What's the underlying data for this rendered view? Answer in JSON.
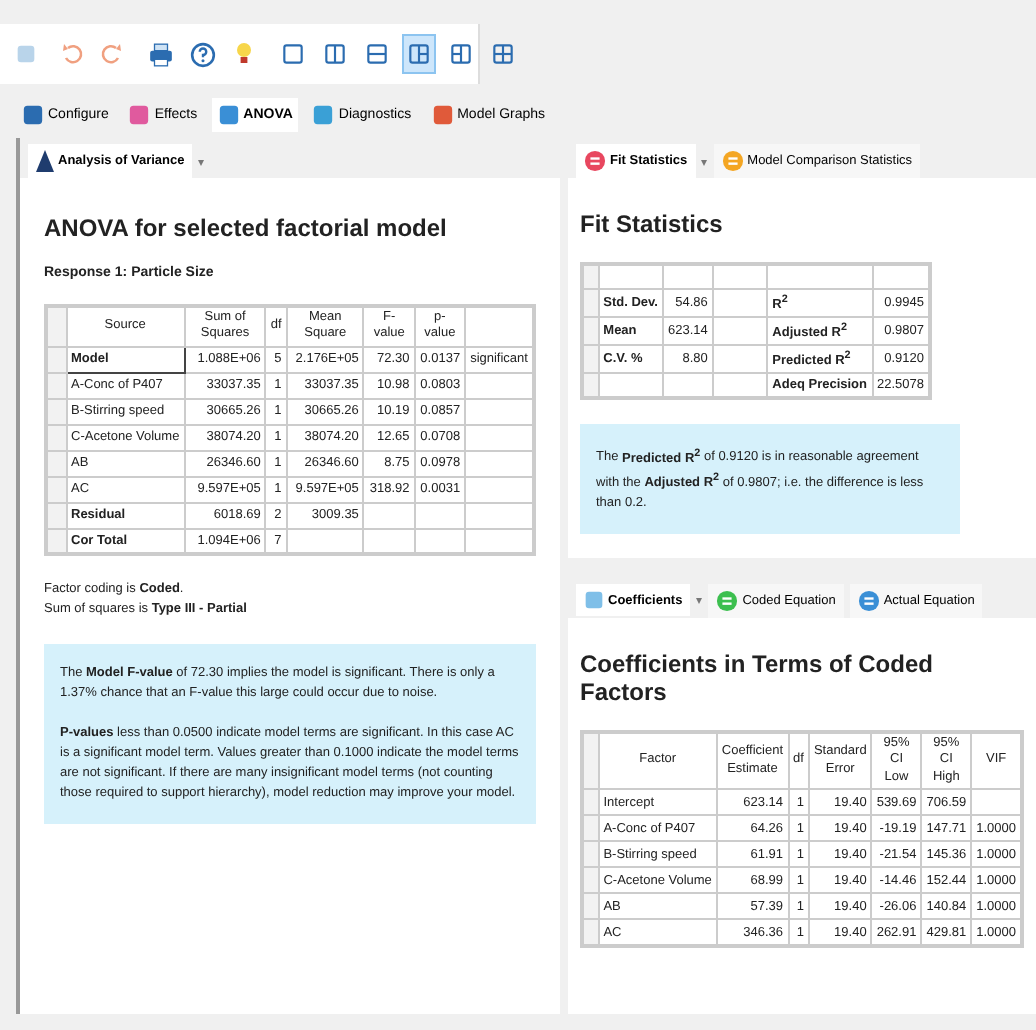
{
  "toolbar": {
    "layouts": [
      {
        "selected": false
      },
      {
        "selected": false
      },
      {
        "selected": false
      },
      {
        "selected": true
      },
      {
        "selected": false
      },
      {
        "selected": false
      }
    ]
  },
  "ribbon_tabs": [
    {
      "label": "Configure",
      "selected": false
    },
    {
      "label": "Effects",
      "selected": false
    },
    {
      "label": "ANOVA",
      "selected": true
    },
    {
      "label": "Diagnostics",
      "selected": false
    },
    {
      "label": "Model Graphs",
      "selected": false
    }
  ],
  "left_panel": {
    "tab": "Analysis of Variance",
    "caret": "▾",
    "title": "ANOVA for selected factorial model",
    "subtitle": "Response 1: Particle Size",
    "table": {
      "columns": [
        "Source",
        "Sum of Squares",
        "df",
        "Mean Square",
        "F-value",
        "p-value"
      ],
      "rows": [
        {
          "cells": [
            "Model",
            "1.088E+06",
            "5",
            "2.176E+05",
            "72.30",
            "0.0137",
            "significant"
          ],
          "bold": true,
          "selected": true
        },
        {
          "cells": [
            "A-Conc of P407",
            "33037.35",
            "1",
            "33037.35",
            "10.98",
            "0.0803",
            ""
          ],
          "bold": false,
          "selected": false
        },
        {
          "cells": [
            "B-Stirring speed",
            "30665.26",
            "1",
            "30665.26",
            "10.19",
            "0.0857",
            ""
          ],
          "bold": false,
          "selected": false
        },
        {
          "cells": [
            "C-Acetone Volume",
            "38074.20",
            "1",
            "38074.20",
            "12.65",
            "0.0708",
            ""
          ],
          "bold": false,
          "selected": false
        },
        {
          "cells": [
            "AB",
            "26346.60",
            "1",
            "26346.60",
            "8.75",
            "0.0978",
            ""
          ],
          "bold": false,
          "selected": false
        },
        {
          "cells": [
            "AC",
            "9.597E+05",
            "1",
            "9.597E+05",
            "318.92",
            "0.0031",
            ""
          ],
          "bold": false,
          "selected": false
        },
        {
          "cells": [
            "Residual",
            "6018.69",
            "2",
            "3009.35",
            "",
            "",
            ""
          ],
          "bold": true,
          "selected": false
        },
        {
          "cells": [
            "Cor Total",
            "1.094E+06",
            "7",
            "",
            "",
            "",
            ""
          ],
          "bold": true,
          "selected": false
        }
      ]
    },
    "notes": [
      "Factor coding is **Coded**.",
      "Sum of squares is **Type III - Partial**"
    ],
    "info": [
      "The **Model F-value** of 72.30 implies the model is significant. There is only a 1.37% chance that an F-value this large could occur due to noise.",
      "**P-values** less than 0.0500 indicate model terms are significant. In this case AC is a significant model term. Values greater than 0.1000 indicate the model terms are not significant. If there are many insignificant model terms (not counting those required to support hierarchy), model reduction may improve your model."
    ]
  },
  "fit_panel": {
    "tabs": [
      {
        "label": "Fit Statistics",
        "selected": true
      },
      {
        "label": "Model Comparison Statistics",
        "selected": false
      }
    ],
    "caret": "▾",
    "title": "Fit Statistics",
    "rows": [
      [
        "Std. Dev.",
        "54.86",
        "R$^{2}$",
        "0.9945"
      ],
      [
        "Mean",
        "623.14",
        "Adjusted R$^{2}$",
        "0.9807"
      ],
      [
        "C.V. %",
        "8.80",
        "Predicted R$^{2}$",
        "0.9120"
      ],
      [
        "",
        "",
        "Adeq Precision",
        "22.5078"
      ]
    ],
    "info": "The **Predicted R$^{2}$** of 0.9120 is in reasonable agreement with the **Adjusted R$^{2}$** of 0.9807; i.e. the difference is less than 0.2."
  },
  "coef_panel": {
    "tabs": [
      {
        "label": "Coefficients",
        "selected": true
      },
      {
        "label": "Coded Equation",
        "selected": false
      },
      {
        "label": "Actual Equation",
        "selected": false
      }
    ],
    "caret": "▾",
    "title": "Coefficients in Terms of Coded Factors",
    "columns": [
      "Factor",
      "Coefficient Estimate",
      "df",
      "Standard Error",
      "95% CI Low",
      "95% CI High",
      "VIF"
    ],
    "rows": [
      [
        "Intercept",
        "623.14",
        "1",
        "19.40",
        "539.69",
        "706.59",
        ""
      ],
      [
        "A-Conc of P407",
        "64.26",
        "1",
        "19.40",
        "-19.19",
        "147.71",
        "1.0000"
      ],
      [
        "B-Stirring speed",
        "61.91",
        "1",
        "19.40",
        "-21.54",
        "145.36",
        "1.0000"
      ],
      [
        "C-Acetone Volume",
        "68.99",
        "1",
        "19.40",
        "-14.46",
        "152.44",
        "1.0000"
      ],
      [
        "AB",
        "57.39",
        "1",
        "19.40",
        "-26.06",
        "140.84",
        "1.0000"
      ],
      [
        "AC",
        "346.36",
        "1",
        "19.40",
        "262.91",
        "429.81",
        "1.0000"
      ]
    ]
  }
}
